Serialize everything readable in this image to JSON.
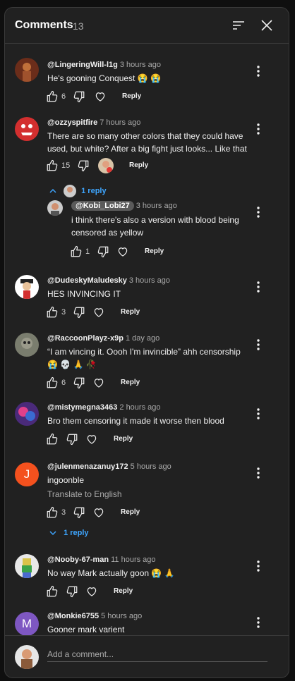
{
  "header": {
    "title": "Comments",
    "count": "13"
  },
  "comments": [
    {
      "author": "@LingeringWill-l1g",
      "time": "3 hours ago",
      "lines": [
        "He's gooning Conquest 😭 😭"
      ],
      "likes": "6",
      "reply_label": "Reply"
    },
    {
      "author": "@ozzyspitfire",
      "time": "7 hours ago",
      "lines": [
        "There are so many other colors that they could have",
        "used, but white? After a big fight just looks... Like that"
      ],
      "likes": "15",
      "reply_label": "Reply",
      "replies_toggle": "1 reply"
    },
    {
      "author": "@Kobi_Lobi27",
      "time": "3 hours ago",
      "lines": [
        "i think there's also a version with blood being",
        "censored as yellow"
      ],
      "likes": "1",
      "reply_label": "Reply"
    },
    {
      "author": "@DudeskyMaludesky",
      "time": "3 hours ago",
      "lines": [
        "HES INVINCING IT"
      ],
      "likes": "3",
      "reply_label": "Reply"
    },
    {
      "author": "@RaccoonPlayz-x9p",
      "time": "1 day ago",
      "lines": [
        "“I am vincing it. Oooh I'm invincible” ahh censorship",
        "😭 💀 🙏 🥀"
      ],
      "likes": "6",
      "reply_label": "Reply"
    },
    {
      "author": "@mistymegna3463",
      "time": "2 hours ago",
      "lines": [
        "Bro them censoring it made it worse then blood"
      ],
      "likes": "",
      "reply_label": "Reply"
    },
    {
      "author": "@julenmenazanuy172",
      "time": "5 hours ago",
      "lines": [
        "ingoonble"
      ],
      "translate": "Translate to English",
      "likes": "3",
      "reply_label": "Reply",
      "replies_toggle": "1 reply",
      "avatar_letter": "J"
    },
    {
      "author": "@Nooby-67-man",
      "time": "11 hours ago",
      "lines": [
        "No way Mark actually goon 😭 🙏"
      ],
      "likes": "",
      "reply_label": "Reply"
    },
    {
      "author": "@Monkie6755",
      "time": "5 hours ago",
      "lines": [
        "Gooner mark varient"
      ],
      "avatar_letter": "M"
    }
  ],
  "footer": {
    "placeholder": "Add a comment..."
  },
  "colors": {
    "accent": "#3ea6ff",
    "avatar_j": "#f4511e",
    "avatar_m": "#7e57c2"
  },
  "icons": [
    "sort-icon",
    "close-icon",
    "like-icon",
    "dislike-icon",
    "heart-icon",
    "more-vert-icon",
    "chevron-up-icon",
    "chevron-down-icon"
  ]
}
